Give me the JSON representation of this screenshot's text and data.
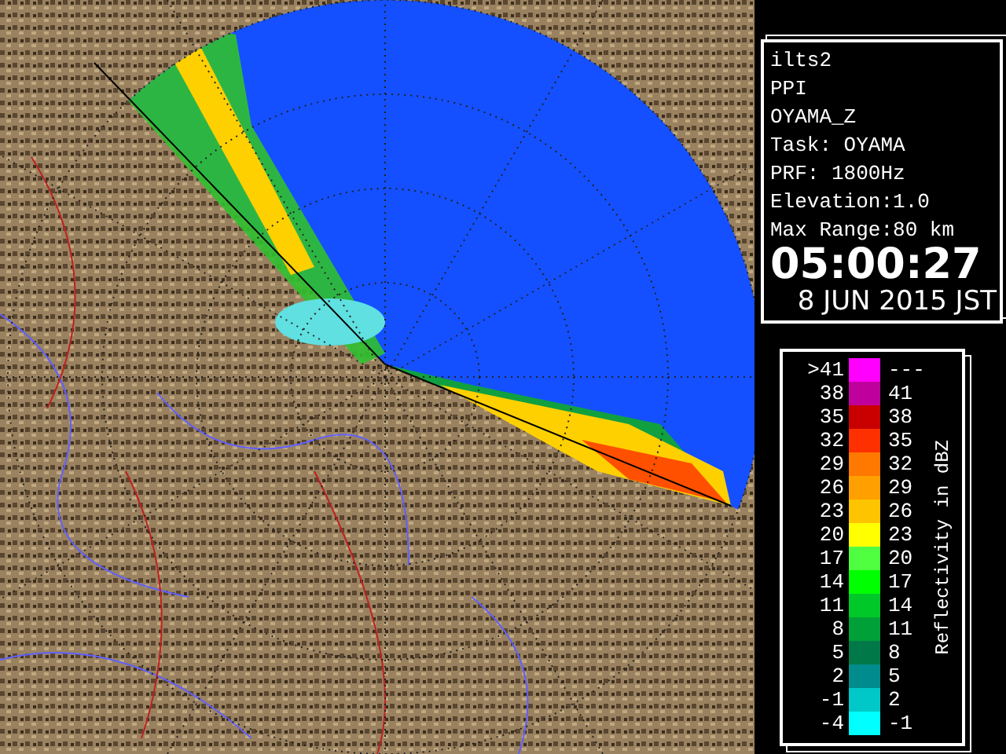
{
  "info_panel": {
    "lines": [
      "ilts2",
      "PPI",
      "OYAMA_Z",
      "Task: OYAMA",
      "PRF: 1800Hz",
      "Elevation:1.0",
      "Max Range:80 km"
    ],
    "time": "05:00:27",
    "date": "8 JUN 2015 JST"
  },
  "legend": {
    "title": "Reflectivity in dBZ",
    "rows": [
      {
        "low": ">41",
        "high": "---",
        "color": "#ff00ff"
      },
      {
        "low": "38",
        "high": "41",
        "color": "#c0009c"
      },
      {
        "low": "35",
        "high": "38",
        "color": "#c80000"
      },
      {
        "low": "32",
        "high": "35",
        "color": "#ff3000"
      },
      {
        "low": "29",
        "high": "32",
        "color": "#ff7800"
      },
      {
        "low": "26",
        "high": "29",
        "color": "#ffa000"
      },
      {
        "low": "23",
        "high": "26",
        "color": "#ffc400"
      },
      {
        "low": "20",
        "high": "23",
        "color": "#ffff00"
      },
      {
        "low": "17",
        "high": "20",
        "color": "#50ff40"
      },
      {
        "low": "14",
        "high": "17",
        "color": "#00ff00"
      },
      {
        "low": "11",
        "high": "14",
        "color": "#00c828"
      },
      {
        "low": "8",
        "high": "11",
        "color": "#00a038"
      },
      {
        "low": "5",
        "high": "8",
        "color": "#007848"
      },
      {
        "low": "2",
        "high": "5",
        "color": "#008c8c"
      },
      {
        "low": "-1",
        "high": "2",
        "color": "#00c8c8"
      },
      {
        "low": "-4",
        "high": "-1",
        "color": "#00ffff"
      }
    ]
  }
}
